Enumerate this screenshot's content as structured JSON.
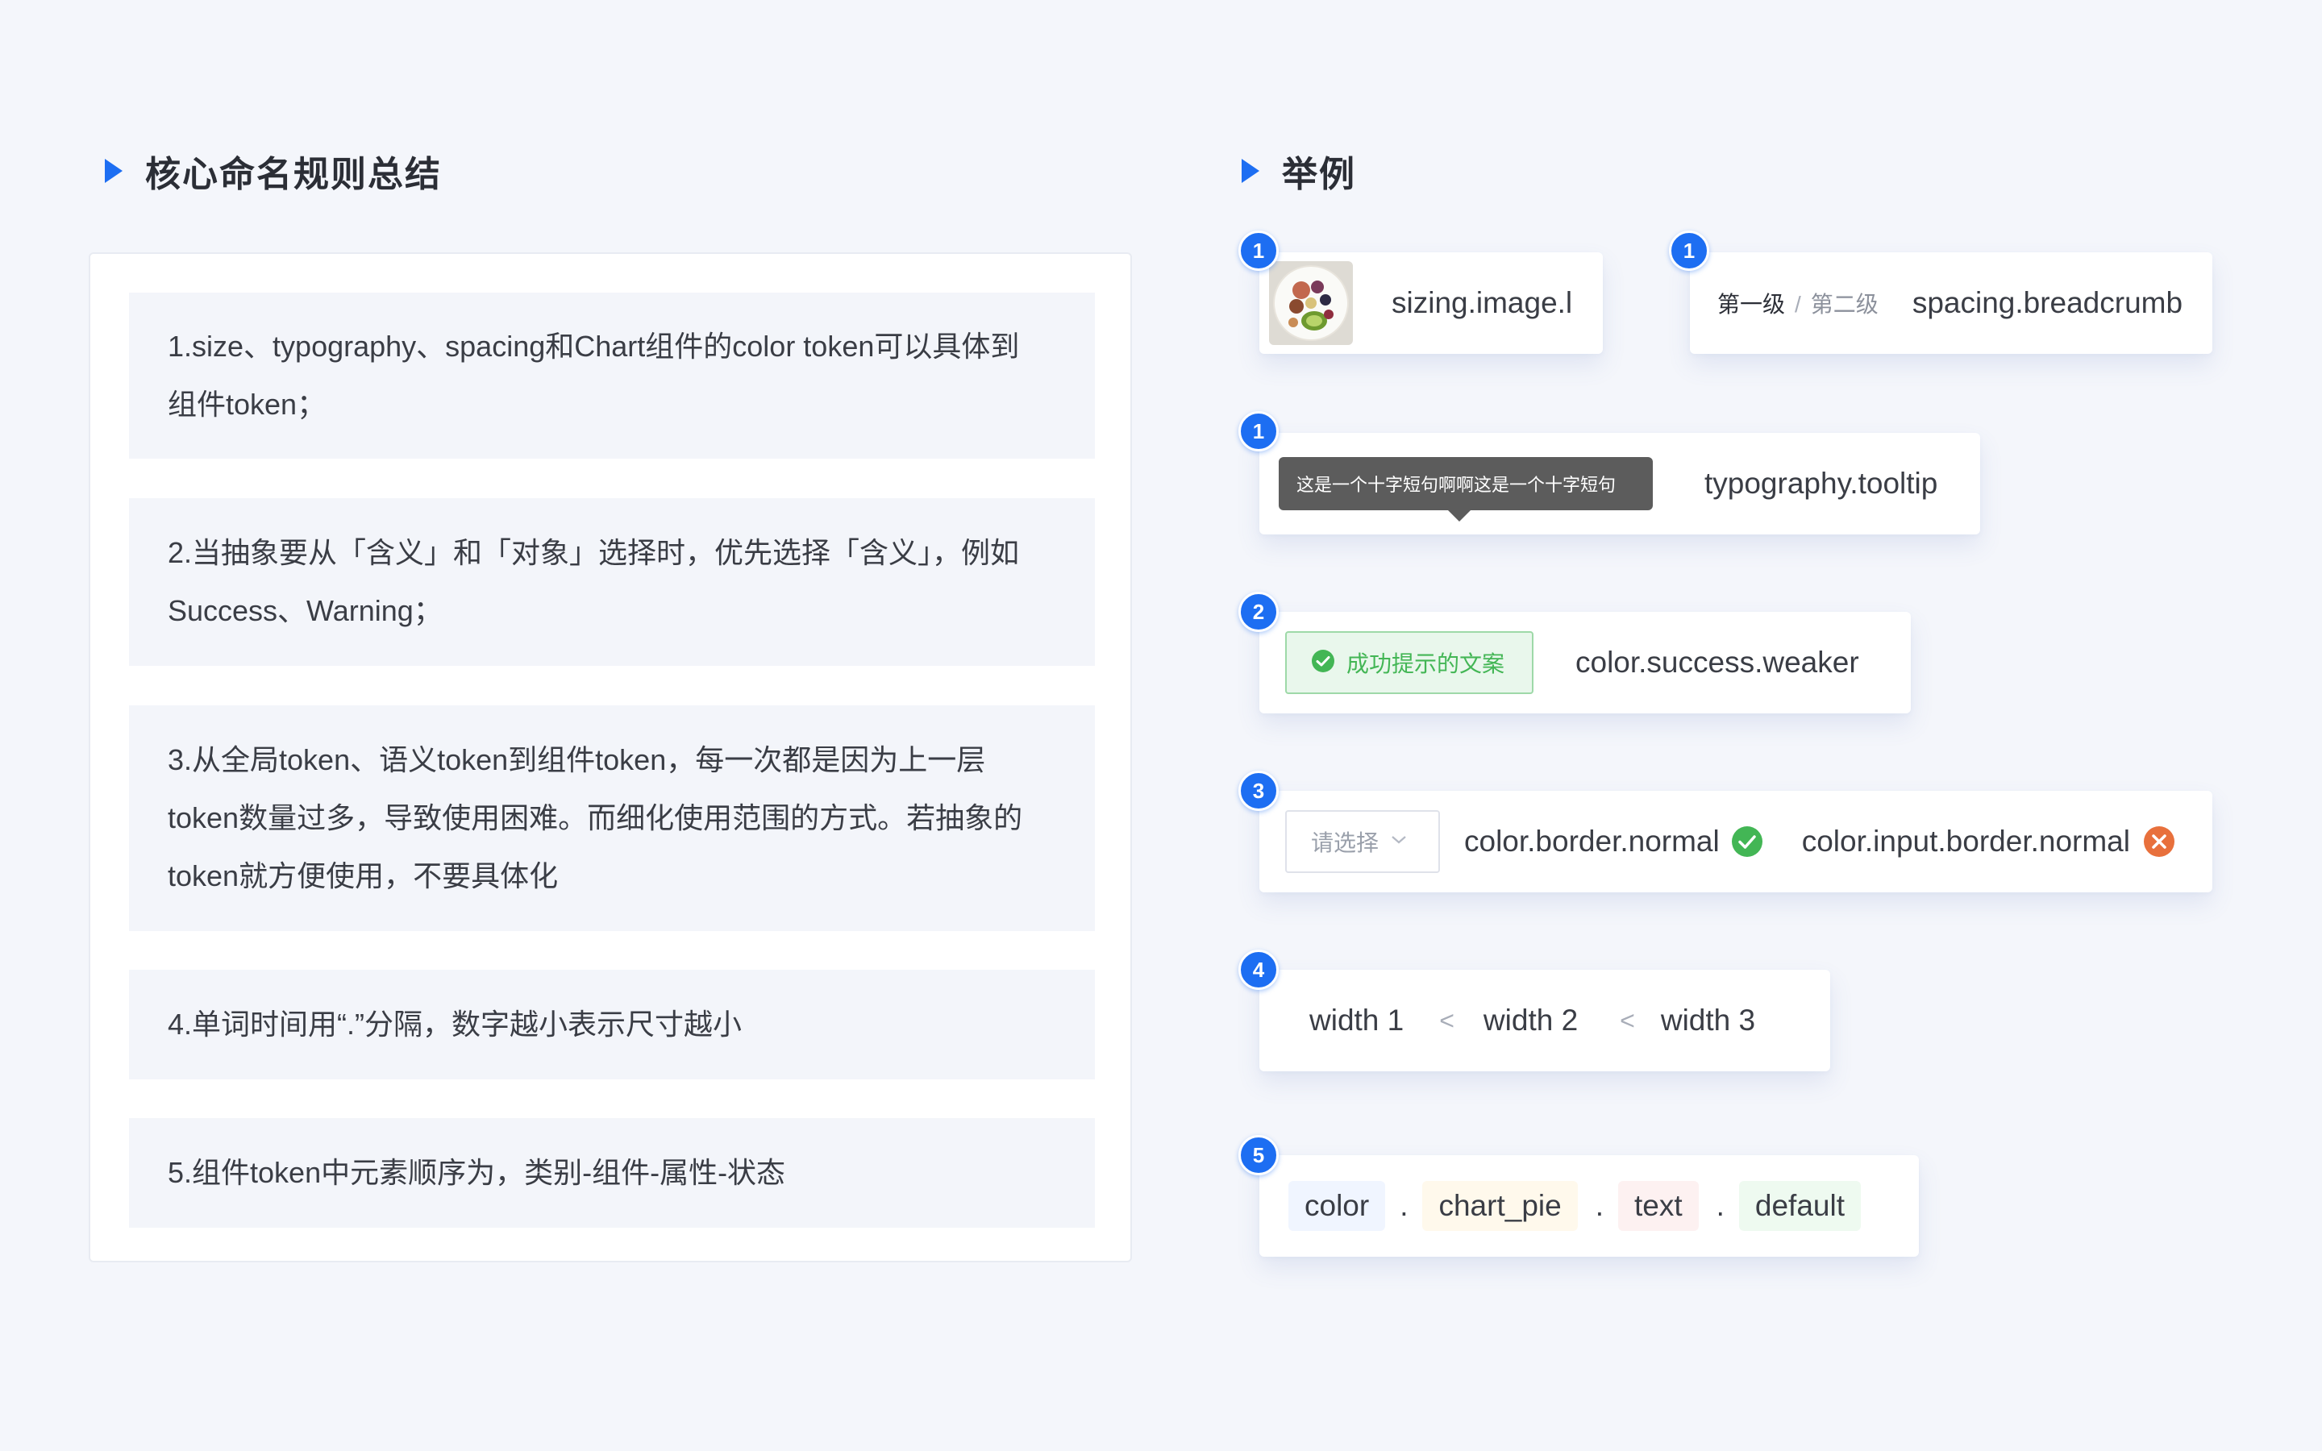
{
  "left": {
    "title": "核心命名规则总结",
    "rules": [
      {
        "lines": [
          "1.size、typography、spacing和Chart组件的color token可以具体到",
          "组件token；"
        ]
      },
      {
        "lines": [
          "2.当抽象要从「含义」和「对象」选择时，优先选择「含义」，例如",
          "Success、Warning；"
        ]
      },
      {
        "lines": [
          "3.从全局token、语义token到组件token，每一次都是因为上一层",
          "token数量过多，导致使用困难。而细化使用范围的方式。若抽象的",
          "token就方便使用，不要具体化"
        ]
      },
      {
        "lines": [
          "4.单词时间用“.”分隔，数字越小表示尺寸越小"
        ]
      },
      {
        "lines": [
          "5.组件token中元素顺序为，类别-组件-属性-状态"
        ]
      }
    ]
  },
  "right": {
    "title": "举例",
    "examples": {
      "image": {
        "badge": "1",
        "token": "sizing.image.l"
      },
      "breadcrumb": {
        "badge": "1",
        "level1": "第一级",
        "separator": "/",
        "level2": "第二级",
        "token": "spacing.breadcrumb"
      },
      "tooltip": {
        "badge": "1",
        "text": "这是一个十字短句啊啊这是一个十字短句",
        "token": "typography.tooltip"
      },
      "success": {
        "badge": "2",
        "tag_text": "成功提示的文案",
        "token": "color.success.weaker"
      },
      "border": {
        "badge": "3",
        "placeholder": "请选择",
        "token_ok": "color.border.normal",
        "token_bad": "color.input.border.normal"
      },
      "width": {
        "badge": "4",
        "w1": "width 1",
        "w2": "width 2",
        "w3": "width 3",
        "lt": "<"
      },
      "order": {
        "badge": "5",
        "parts": [
          "color",
          "chart_pie",
          "text",
          "default"
        ],
        "dot": "."
      }
    },
    "colors": {
      "accent": "#1d6ef2",
      "success": "#43b655",
      "error": "#e8703c",
      "pill_blue": "#f0f5ff",
      "pill_yellow": "#fff9ec",
      "pill_red": "#fdf1f1",
      "pill_green": "#eefaf0"
    }
  }
}
